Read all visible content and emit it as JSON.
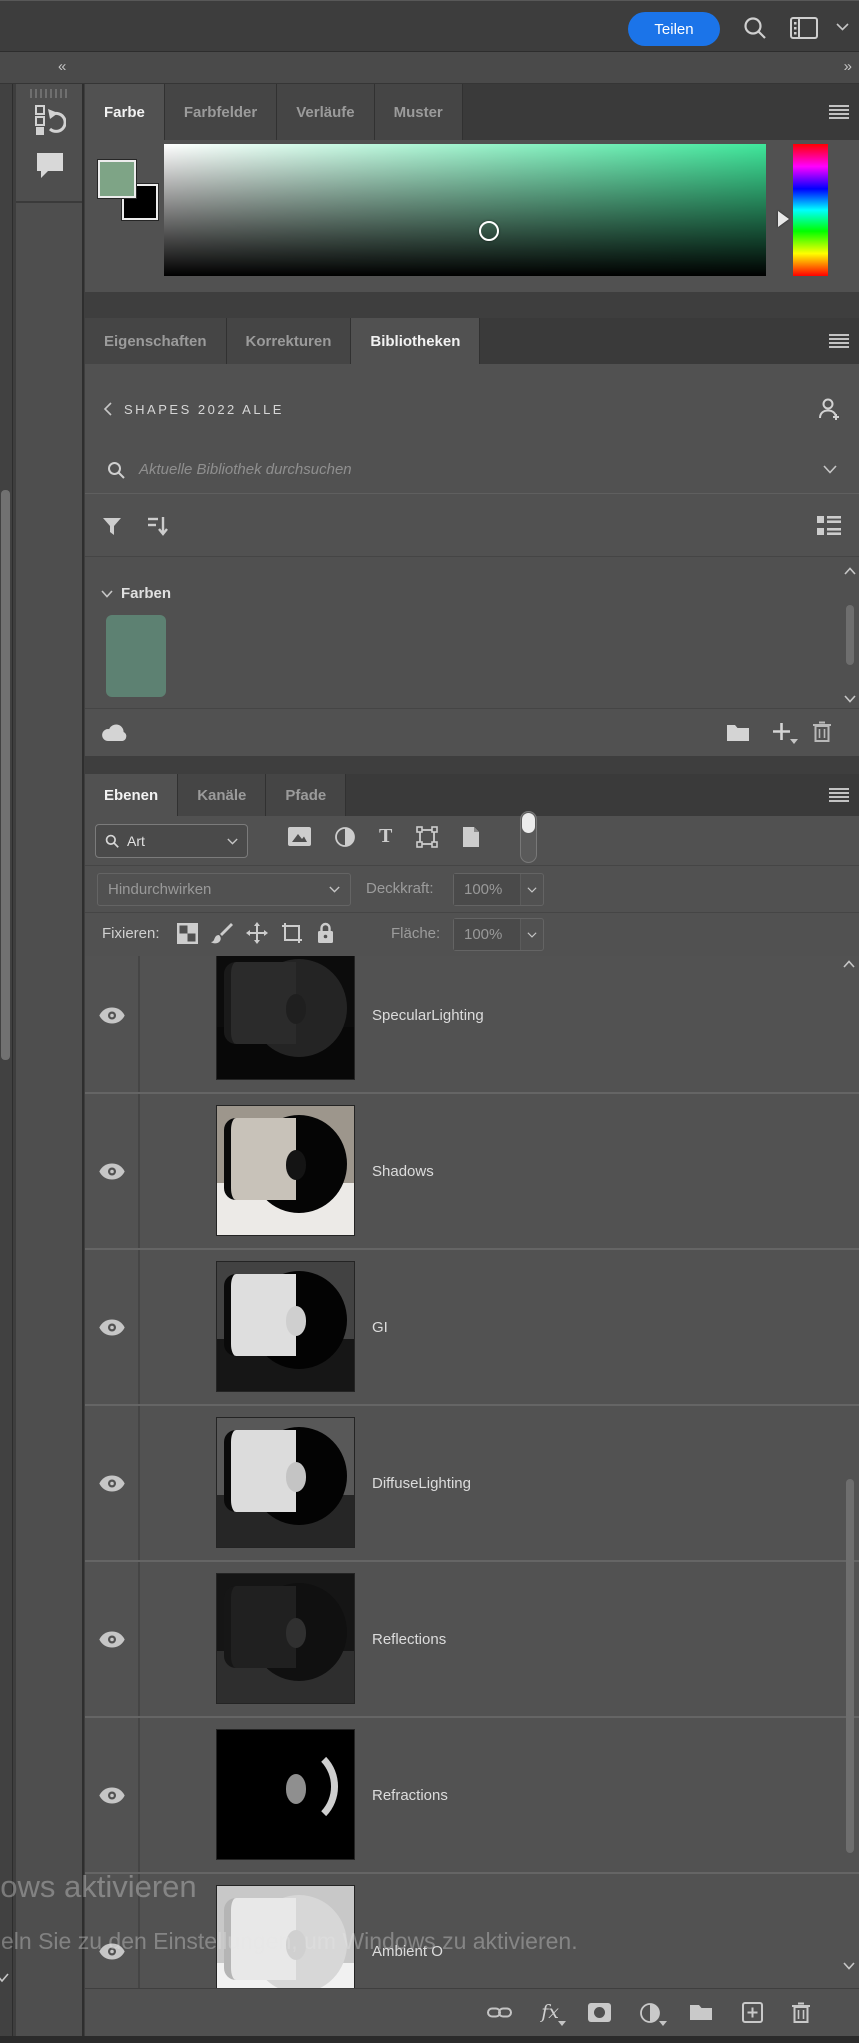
{
  "topbar": {
    "share_label": "Teilen"
  },
  "dock": {
    "collapse_left": "«",
    "collapse_right": "»"
  },
  "color_panel": {
    "tabs": [
      {
        "label": "Farbe",
        "active": true
      },
      {
        "label": "Farbfelder"
      },
      {
        "label": "Verläufe"
      },
      {
        "label": "Muster"
      }
    ],
    "foreground_color": "#7ea486",
    "background_color": "#000000",
    "gradient_hue": "#3fe79b"
  },
  "libraries_panel": {
    "tabs": [
      {
        "label": "Eigenschaften"
      },
      {
        "label": "Korrekturen"
      },
      {
        "label": "Bibliotheken",
        "active": true
      }
    ],
    "library_title": "SHAPES 2022 ALLE",
    "search_placeholder": "Aktuelle Bibliothek durchsuchen",
    "group_header": "Farben",
    "swatch_color": "#5d8172"
  },
  "layers_panel": {
    "tabs": [
      {
        "label": "Ebenen",
        "active": true
      },
      {
        "label": "Kanäle"
      },
      {
        "label": "Pfade"
      }
    ],
    "filter_label": "Art",
    "blend_mode": "Hindurchwirken",
    "opacity_label": "Deckkraft:",
    "opacity_value": "100%",
    "lock_label": "Fixieren:",
    "fill_label": "Fläche:",
    "fill_value": "100%",
    "layers": [
      {
        "name": "SpecularLighting",
        "thumb": {
          "wall": "#0c0c0c",
          "ground": "#080808",
          "disc": "#242424",
          "face": "#2b2b2b",
          "edge": "#1a1a1a",
          "notch": "#1f1f1f"
        }
      },
      {
        "name": "Shadows",
        "thumb": {
          "wall": "#9d968c",
          "ground": "#eceae7",
          "disc": "#050505",
          "face": "#c8c2b9",
          "edge": "#0a0a0a",
          "notch": "#141414"
        }
      },
      {
        "name": "GI",
        "thumb": {
          "wall": "#424242",
          "ground": "#161616",
          "disc": "#030303",
          "face": "#dedede",
          "edge": "#0a0a0a",
          "notch": "#cfcfcf"
        }
      },
      {
        "name": "DiffuseLighting",
        "thumb": {
          "wall": "#585858",
          "ground": "#262626",
          "disc": "#030303",
          "face": "#dcdcdc",
          "edge": "#0a0a0a",
          "notch": "#c4c4c4"
        }
      },
      {
        "name": "Reflections",
        "thumb": {
          "wall": "#151515",
          "ground": "#2e2e2e",
          "disc": "#101010",
          "face": "#202020",
          "edge": "#161616",
          "notch": "#303030"
        }
      },
      {
        "name": "Refractions",
        "thumb": {
          "wall": "#000000",
          "ground": "#000000",
          "disc": "#000000",
          "face": "#000000",
          "edge": "#000000",
          "notch": "#8f8f8f",
          "arc": "#cfcfcf"
        }
      },
      {
        "name": "Ambient O",
        "thumb": {
          "wall": "#c8c8c8",
          "ground": "#f1f1f1",
          "disc": "#d7d7d7",
          "face": "#e8e8e8",
          "edge": "#b5b5b5",
          "notch": "#d0d0d0"
        }
      }
    ]
  },
  "watermark": {
    "line1": "dows aktivieren",
    "line2": "eln Sie zu den Einstellungen, um Windows zu aktivieren."
  },
  "colors": {
    "accent_blue": "#1b74e9",
    "panel_background": "#515151",
    "tabstrip_background": "#3a3a3a"
  }
}
